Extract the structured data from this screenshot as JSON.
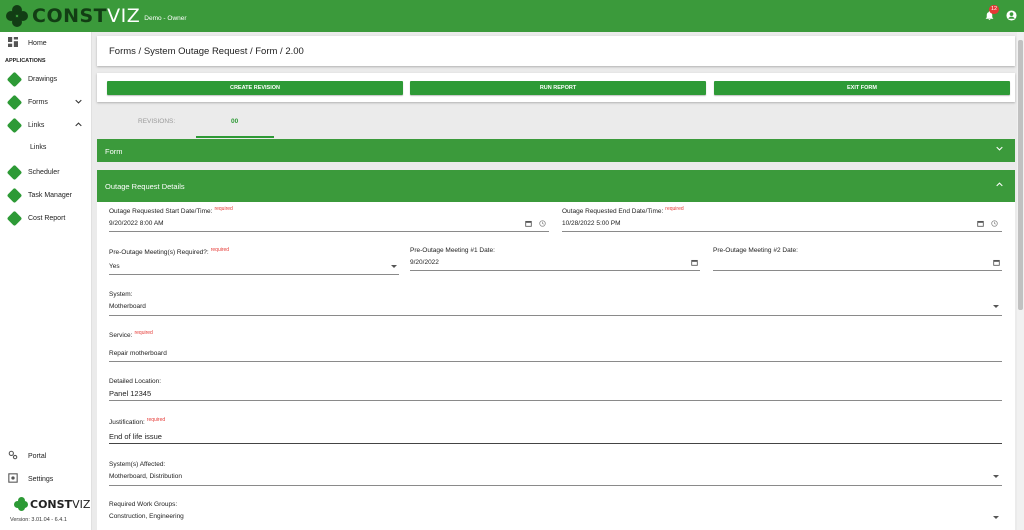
{
  "app": {
    "brand_primary": "CONST",
    "brand_secondary": "VIZ",
    "org": "Demo - Owner",
    "notification_count": "12",
    "accent_color": "#3b9a3b"
  },
  "sidebar": {
    "home": "Home",
    "applications_heading": "APPLICATIONS",
    "drawings": "Drawings",
    "forms": "Forms",
    "links": "Links",
    "links_sub": "Links",
    "scheduler": "Scheduler",
    "task_manager": "Task Manager",
    "cost_report": "Cost Report",
    "portal": "Portal",
    "settings": "Settings",
    "version": "Version: 3.01.04 - 6.4.1"
  },
  "breadcrumb": "Forms / System Outage Request / Form / 2.00",
  "actions": {
    "create_revision": "CREATE REVISION",
    "run_report": "RUN REPORT",
    "exit_form": "EXIT FORM"
  },
  "tabs": {
    "revisions_label": "REVISIONS:",
    "revision_value": "00"
  },
  "sections": {
    "form": "Form",
    "details": "Outage Request Details"
  },
  "required_text": "required",
  "fields": {
    "start_label": "Outage Requested Start Date/Time:",
    "start_value": "9/20/2022 8:00 AM",
    "end_label": "Outage Requested End Date/Time:",
    "end_value": "10/28/2022 5:00 PM",
    "pre_meeting_label": "Pre-Outage Meeting(s) Required?:",
    "pre_meeting_value": "Yes",
    "meeting1_label": "Pre-Outage Meeting #1 Date:",
    "meeting1_value": "9/20/2022",
    "meeting2_label": "Pre-Outage Meeting #2 Date:",
    "meeting2_value": "",
    "system_label": "System:",
    "system_value": "Motherboard",
    "service_label": "Service:",
    "service_value": "Repair motherboard",
    "location_label": "Detailed Location:",
    "location_value": "Panel 12345",
    "justification_label": "Justification:",
    "justification_value": "End of life issue",
    "affected_label": "System(s) Affected:",
    "affected_value": "Motherboard, Distribution",
    "work_groups_label": "Required Work Groups:",
    "work_groups_value": "Construction, Engineering"
  }
}
